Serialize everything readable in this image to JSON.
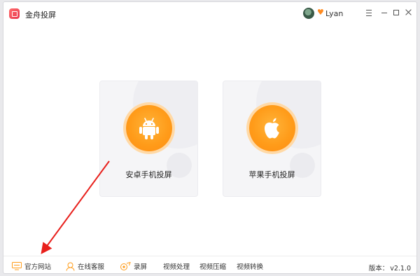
{
  "app": {
    "title": "金舟投屏"
  },
  "user": {
    "name": "Lyan",
    "vip_icon": "vip-badge-icon"
  },
  "window_controls": [
    "menu",
    "minimize",
    "maximize",
    "close"
  ],
  "cards": [
    {
      "label": "安卓手机投屏",
      "icon": "android-icon"
    },
    {
      "label": "苹果手机投屏",
      "icon": "apple-icon"
    }
  ],
  "bottom_bar": {
    "official_site": "官方网站",
    "online_service": "在线客服",
    "record": "录屏",
    "video_process": "视频处理",
    "video_compress": "视频压缩",
    "video_convert": "视频转换",
    "version_label": "版本：",
    "version_value": "v2.1.0"
  },
  "colors": {
    "accent": "#ff9c1a",
    "annotation_arrow": "#e8201c"
  }
}
